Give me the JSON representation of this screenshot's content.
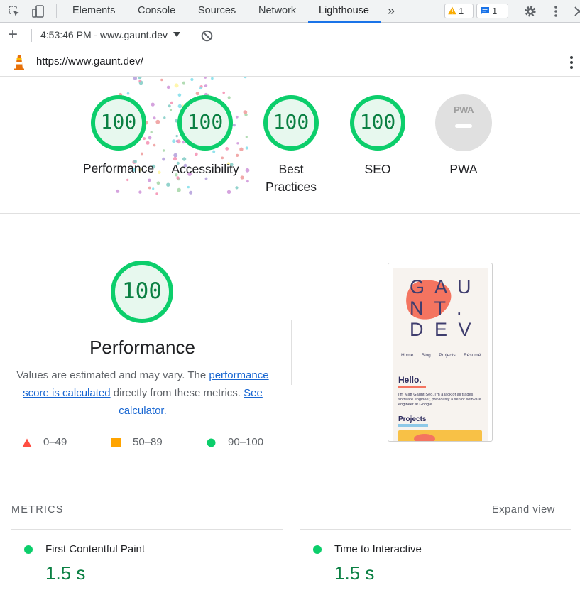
{
  "devtools": {
    "tabs": [
      "Elements",
      "Console",
      "Sources",
      "Network",
      "Lighthouse"
    ],
    "more_tabs_icon": "»",
    "warnings_count": "1",
    "messages_count": "1"
  },
  "toolbar": {
    "add_icon": "+",
    "report_selector": "4:53:46 PM - www.gaunt.dev"
  },
  "urlbar": {
    "url": "https://www.gaunt.dev/"
  },
  "gauges": [
    {
      "score": "100",
      "label": "Performance"
    },
    {
      "score": "100",
      "label": "Accessibility"
    },
    {
      "score": "100",
      "label": "Best Practices"
    },
    {
      "score": "100",
      "label": "SEO"
    },
    {
      "score": "",
      "label": "PWA",
      "badge": "PWA"
    }
  ],
  "performance": {
    "score": "100",
    "title": "Performance",
    "desc_text1": "Values are estimated and may vary. The ",
    "desc_link1": "performance score is calculated",
    "desc_text2": " directly from these metrics. ",
    "desc_link2": "See calculator."
  },
  "legend": {
    "fail": "0–49",
    "average": "50–89",
    "pass": "90–100"
  },
  "screenshot": {
    "logo_lines": [
      "G A U",
      "N T .",
      "D E V"
    ],
    "nav": [
      "Home",
      "Blog",
      "Projects",
      "Résumé"
    ],
    "hello": "Hello.",
    "intro": "I'm Matt Gaunt-Seo, I'm a jack of all trades software engineer, previously a senior software engineer at Google.",
    "projects": "Projects"
  },
  "metrics": {
    "title": "METRICS",
    "expand": "Expand view",
    "items": [
      {
        "label": "First Contentful Paint",
        "value": "1.5 s"
      },
      {
        "label": "Time to Interactive",
        "value": "1.5 s"
      }
    ]
  },
  "colors": {
    "pass": "#0cce6b",
    "pass_text": "#0b8043",
    "average": "#ffa400",
    "fail": "#ff4e42",
    "link": "#1967d2",
    "active_tab": "#1a73e8"
  }
}
